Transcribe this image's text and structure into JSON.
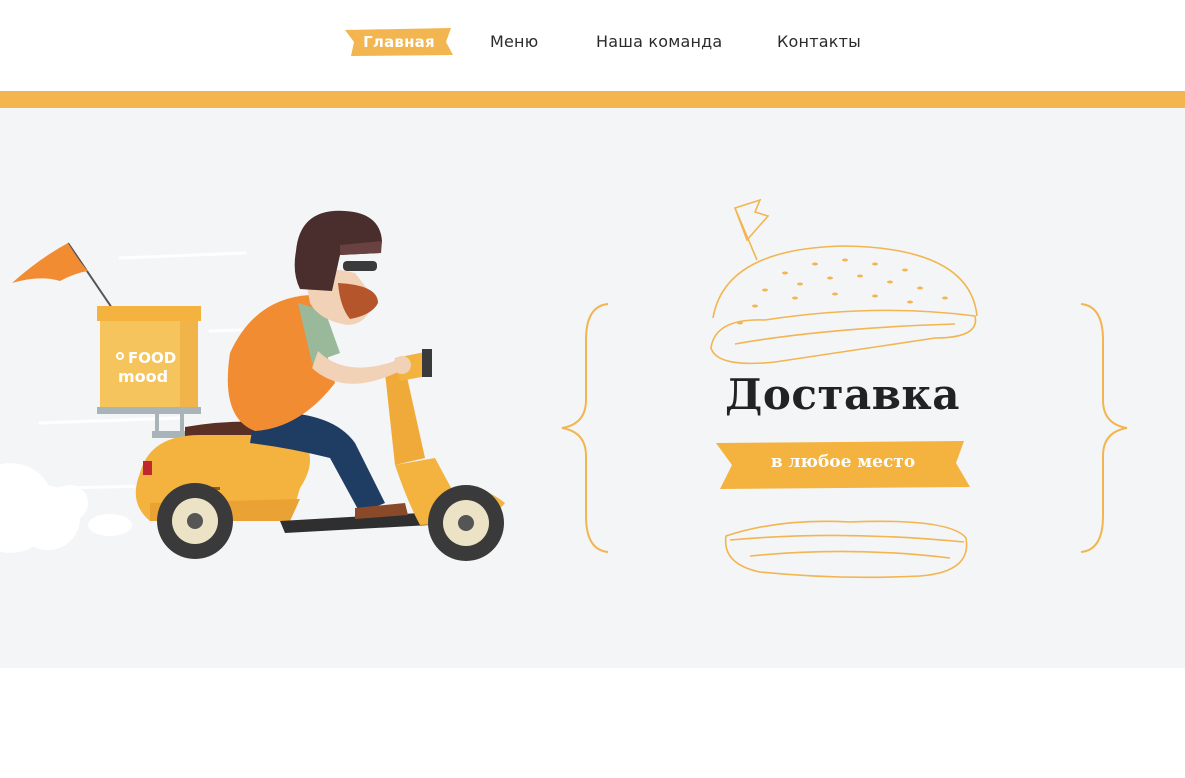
{
  "nav": {
    "items": [
      {
        "label": "Главная",
        "active": true
      },
      {
        "label": "Меню",
        "active": false
      },
      {
        "label": "Наша команда",
        "active": false
      },
      {
        "label": "Контакты",
        "active": false
      }
    ]
  },
  "hero": {
    "title": "Доставка",
    "subtitle": "в любое место",
    "box_logo_line1": "FOOD",
    "box_logo_line2": "mood"
  },
  "colors": {
    "accent": "#f2b550",
    "ribbon": "#f4b23e",
    "hero_bg": "#f4f5f6",
    "text_dark": "#222222"
  }
}
